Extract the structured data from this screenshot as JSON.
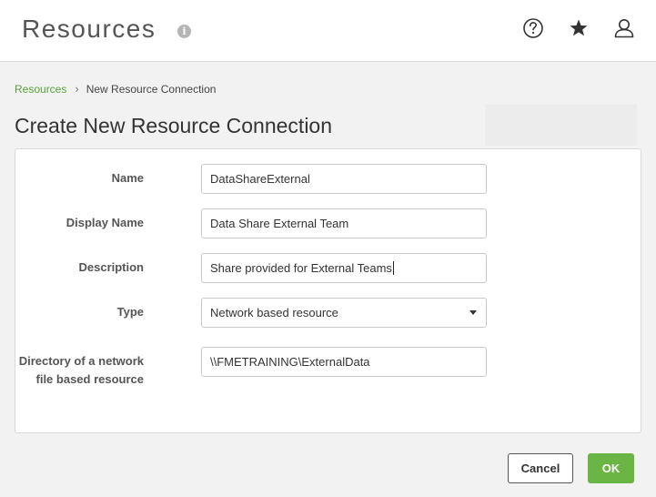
{
  "header": {
    "title": "Resources",
    "info_icon": "info-icon",
    "help_icon": "help-circle-icon",
    "favorites_icon": "star-icon",
    "user_icon": "user-icon"
  },
  "breadcrumb": {
    "parent": "Resources",
    "current": "New Resource Connection"
  },
  "form": {
    "title": "Create New Resource Connection",
    "fields": [
      {
        "label": "Name",
        "value": "DataShareExternal"
      },
      {
        "label": "Display Name",
        "value": "Data Share External Team"
      },
      {
        "label": "Description",
        "value": "Share provided for External Teams"
      },
      {
        "label": "Type",
        "value": "Network based resource",
        "options": [
          "Network based resource"
        ]
      },
      {
        "label": "Directory of a network file based resource",
        "value": "\\\\FMETRAINING\\ExternalData"
      }
    ]
  },
  "actions": {
    "cancel_label": "Cancel",
    "ok_label": "OK"
  },
  "colors": {
    "accent": "#6bb545",
    "link": "#5aa13c"
  }
}
